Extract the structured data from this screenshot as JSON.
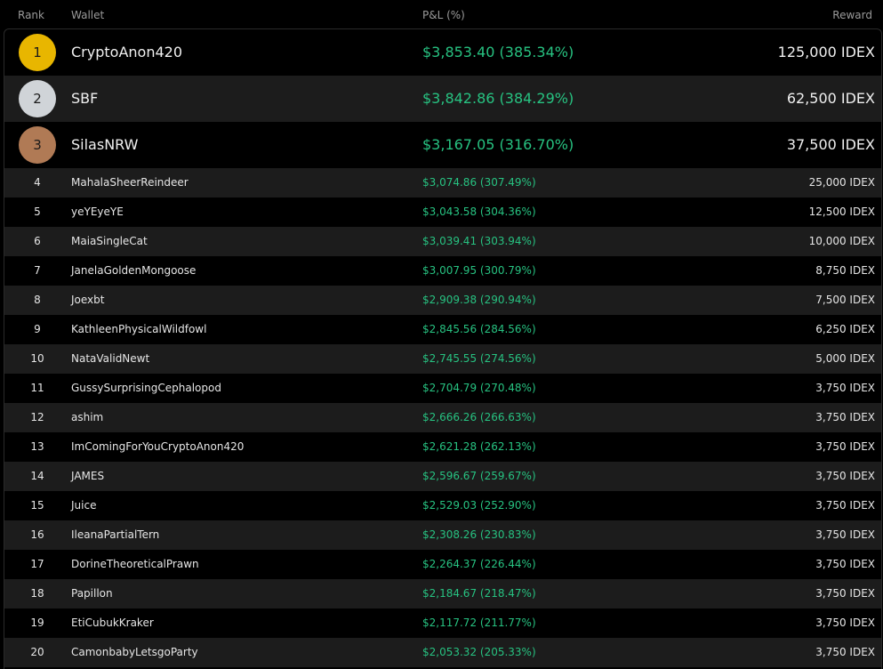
{
  "header": {
    "rank": "Rank",
    "wallet": "Wallet",
    "pnl": "P&L (%)",
    "reward": "Reward"
  },
  "colors": {
    "gold": "#e8b600",
    "silver": "#d0d4d8",
    "bronze": "#b07a55",
    "positive": "#27c281",
    "row_alt": "#1c1c1c",
    "background": "#000000"
  },
  "top": [
    {
      "rank": "1",
      "wallet": "CryptoAnon420",
      "pnl": "$3,853.40 (385.34%)",
      "reward": "125,000 IDEX",
      "medal": "gold"
    },
    {
      "rank": "2",
      "wallet": "SBF",
      "pnl": "$3,842.86 (384.29%)",
      "reward": "62,500 IDEX",
      "medal": "silver"
    },
    {
      "rank": "3",
      "wallet": "SilasNRW",
      "pnl": "$3,167.05 (316.70%)",
      "reward": "37,500 IDEX",
      "medal": "bronze"
    }
  ],
  "rows": [
    {
      "rank": "4",
      "wallet": "MahalaSheerReindeer",
      "pnl": "$3,074.86 (307.49%)",
      "reward": "25,000 IDEX"
    },
    {
      "rank": "5",
      "wallet": "yeYEyeYE",
      "pnl": "$3,043.58 (304.36%)",
      "reward": "12,500 IDEX"
    },
    {
      "rank": "6",
      "wallet": "MaiaSingleCat",
      "pnl": "$3,039.41 (303.94%)",
      "reward": "10,000 IDEX"
    },
    {
      "rank": "7",
      "wallet": "JanelaGoldenMongoose",
      "pnl": "$3,007.95 (300.79%)",
      "reward": "8,750 IDEX"
    },
    {
      "rank": "8",
      "wallet": "Joexbt",
      "pnl": "$2,909.38 (290.94%)",
      "reward": "7,500 IDEX"
    },
    {
      "rank": "9",
      "wallet": "KathleenPhysicalWildfowl",
      "pnl": "$2,845.56 (284.56%)",
      "reward": "6,250 IDEX"
    },
    {
      "rank": "10",
      "wallet": "NataValidNewt",
      "pnl": "$2,745.55 (274.56%)",
      "reward": "5,000 IDEX"
    },
    {
      "rank": "11",
      "wallet": "GussySurprisingCephalopod",
      "pnl": "$2,704.79 (270.48%)",
      "reward": "3,750 IDEX"
    },
    {
      "rank": "12",
      "wallet": "ashim",
      "pnl": "$2,666.26 (266.63%)",
      "reward": "3,750 IDEX"
    },
    {
      "rank": "13",
      "wallet": "ImComingForYouCryptoAnon420",
      "pnl": "$2,621.28 (262.13%)",
      "reward": "3,750 IDEX"
    },
    {
      "rank": "14",
      "wallet": "JAMES",
      "pnl": "$2,596.67 (259.67%)",
      "reward": "3,750 IDEX"
    },
    {
      "rank": "15",
      "wallet": "Juice",
      "pnl": "$2,529.03 (252.90%)",
      "reward": "3,750 IDEX"
    },
    {
      "rank": "16",
      "wallet": "IleanaPartialTern",
      "pnl": "$2,308.26 (230.83%)",
      "reward": "3,750 IDEX"
    },
    {
      "rank": "17",
      "wallet": "DorineTheoreticalPrawn",
      "pnl": "$2,264.37 (226.44%)",
      "reward": "3,750 IDEX"
    },
    {
      "rank": "18",
      "wallet": "Papillon",
      "pnl": "$2,184.67 (218.47%)",
      "reward": "3,750 IDEX"
    },
    {
      "rank": "19",
      "wallet": "EtiCubukKraker",
      "pnl": "$2,117.72 (211.77%)",
      "reward": "3,750 IDEX"
    },
    {
      "rank": "20",
      "wallet": "CamonbabyLetsgoParty",
      "pnl": "$2,053.32 (205.33%)",
      "reward": "3,750 IDEX"
    }
  ]
}
